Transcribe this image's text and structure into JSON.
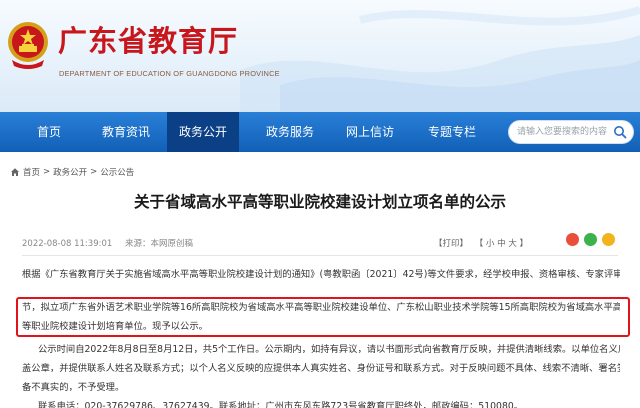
{
  "site": {
    "title": "广东省教育厅",
    "subtitle": "DEPARTMENT OF EDUCATION OF GUANGDONG PROVINCE"
  },
  "nav": {
    "items": [
      {
        "label": "首页"
      },
      {
        "label": "教育资讯"
      },
      {
        "label": "政务公开"
      },
      {
        "label": "政务服务"
      },
      {
        "label": "网上信访"
      },
      {
        "label": "专题专栏"
      }
    ],
    "active_index": 2
  },
  "search": {
    "placeholder": "请输入您要搜索的内容"
  },
  "breadcrumb": {
    "home": "首页",
    "sep": ">",
    "level1": "政务公开",
    "level2": "公示公告"
  },
  "article": {
    "title": "关于省域高水平高等职业院校建设计划立项名单的公示",
    "date": "2022-08-08 11:39:01",
    "source": "来源：本网原创稿",
    "print": "【打印】",
    "font_size": "【 小  中  大 】",
    "lines": [
      "根据《广东省教育厅关于实施省域高水平高等职业院校建设计划的通知》(粤教职函〔2021〕42号)等文件要求，经学校申报、资格审核、专家评审等环",
      "节，拟立项广东省外语艺术职业学院等16所高职院校为省域高水平高等职业院校建设单位、广东松山职业技术学院等15所高职院校为省域高水平高",
      "等职业院校建设计划培育单位。现予以公示。",
      "公示时间自2022年8月8日至8月12日，共5个工作日。公示期内，如持有异议，请以书面形式向省教育厅反映，并提供清晰线索。以单位名义反映的应加",
      "盖公章，并提供联系人姓名及联系方式；以个人名义反映的应提供本人真实姓名、身份证号和联系方式。对于反映问题不具体、线索不清晰、署名签章不完",
      "备不真实的，不予受理。",
      "联系电话：020-37629786、37627439。联系地址：广州市东风东路723号省教育厅职终处，邮政编码：510080。"
    ]
  },
  "colors": {
    "brand_red": "#c8161d",
    "nav_blue": "#1668c1",
    "nav_active": "#0b3f86",
    "highlight": "#e1141c"
  }
}
